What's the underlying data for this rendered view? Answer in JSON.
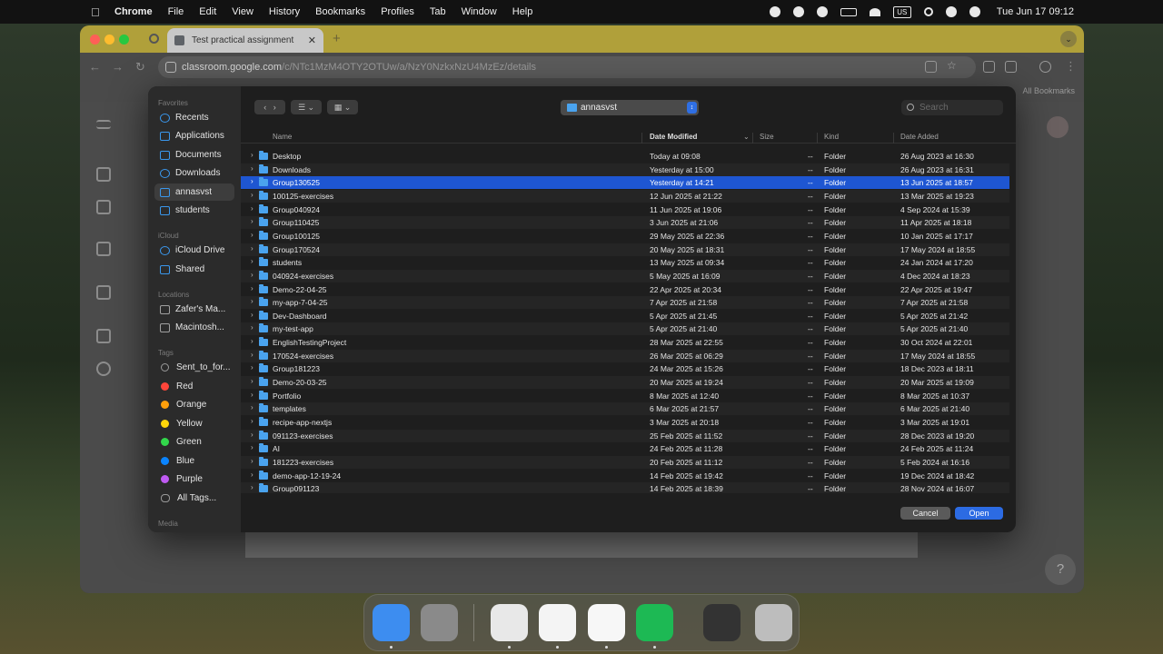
{
  "menubar": {
    "app": "Chrome",
    "items": [
      "File",
      "Edit",
      "View",
      "History",
      "Bookmarks",
      "Profiles",
      "Tab",
      "Window",
      "Help"
    ],
    "input_source": "US",
    "clock": "Tue Jun 17  09:12"
  },
  "browser": {
    "tab_title": "Test practical assignment",
    "url_host": "classroom.google.com",
    "url_path": "/c/NTc1MzM4OTY2OTUw/a/NzY0NzkxNzU4MzEz/details",
    "bookmarks_all": "All Bookmarks"
  },
  "dialog": {
    "sidebar": {
      "favorites_label": "Favorites",
      "favorites": [
        {
          "label": "Recents",
          "icon": "clock-icon"
        },
        {
          "label": "Applications",
          "icon": "applications-icon"
        },
        {
          "label": "Documents",
          "icon": "document-icon"
        },
        {
          "label": "Downloads",
          "icon": "download-icon"
        },
        {
          "label": "annasvst",
          "icon": "home-icon"
        },
        {
          "label": "students",
          "icon": "folder-icon"
        }
      ],
      "icloud_label": "iCloud",
      "icloud": [
        {
          "label": "iCloud Drive",
          "icon": "cloud-icon"
        },
        {
          "label": "Shared",
          "icon": "shared-folder-icon"
        }
      ],
      "locations_label": "Locations",
      "locations": [
        {
          "label": "Zafer's Ma...",
          "icon": "laptop-icon"
        },
        {
          "label": "Macintosh...",
          "icon": "disk-icon"
        }
      ],
      "tags_label": "Tags",
      "tags": [
        {
          "label": "Sent_to_for...",
          "color": "#9a9a9a"
        },
        {
          "label": "Red",
          "color": "#ff453a"
        },
        {
          "label": "Orange",
          "color": "#ff9f0a"
        },
        {
          "label": "Yellow",
          "color": "#ffd60a"
        },
        {
          "label": "Green",
          "color": "#32d74b"
        },
        {
          "label": "Blue",
          "color": "#0a84ff"
        },
        {
          "label": "Purple",
          "color": "#bf5af2"
        },
        {
          "label": "All Tags...",
          "color": "#9a9a9a"
        }
      ],
      "media_label": "Media"
    },
    "current_folder": "annasvst",
    "search_placeholder": "Search",
    "columns": {
      "name": "Name",
      "modified": "Date Modified",
      "size": "Size",
      "kind": "Kind",
      "added": "Date Added"
    },
    "rows": [
      {
        "name": "Desktop",
        "modified": "Today at 09:08",
        "size": "--",
        "kind": "Folder",
        "added": "26 Aug 2023 at 16:30"
      },
      {
        "name": "Downloads",
        "modified": "Yesterday at 15:00",
        "size": "--",
        "kind": "Folder",
        "added": "26 Aug 2023 at 16:31"
      },
      {
        "name": "Group130525",
        "modified": "Yesterday at 14:21",
        "size": "--",
        "kind": "Folder",
        "added": "13 Jun 2025 at 18:57"
      },
      {
        "name": "100125-exercises",
        "modified": "12 Jun 2025 at 21:22",
        "size": "--",
        "kind": "Folder",
        "added": "13 Mar 2025 at 19:23"
      },
      {
        "name": "Group040924",
        "modified": "11 Jun 2025 at 19:06",
        "size": "--",
        "kind": "Folder",
        "added": "4 Sep 2024 at 15:39"
      },
      {
        "name": "Group110425",
        "modified": "3 Jun 2025 at 21:06",
        "size": "--",
        "kind": "Folder",
        "added": "11 Apr 2025 at 18:18"
      },
      {
        "name": "Group100125",
        "modified": "29 May 2025 at 22:36",
        "size": "--",
        "kind": "Folder",
        "added": "10 Jan 2025 at 17:17"
      },
      {
        "name": "Group170524",
        "modified": "20 May 2025 at 18:31",
        "size": "--",
        "kind": "Folder",
        "added": "17 May 2024 at 18:55"
      },
      {
        "name": "students",
        "modified": "13 May 2025 at 09:34",
        "size": "--",
        "kind": "Folder",
        "added": "24 Jan 2024 at 17:20"
      },
      {
        "name": "040924-exercises",
        "modified": "5 May 2025 at 16:09",
        "size": "--",
        "kind": "Folder",
        "added": "4 Dec 2024 at 18:23"
      },
      {
        "name": "Demo-22-04-25",
        "modified": "22 Apr 2025 at 20:34",
        "size": "--",
        "kind": "Folder",
        "added": "22 Apr 2025 at 19:47"
      },
      {
        "name": "my-app-7-04-25",
        "modified": "7 Apr 2025 at 21:58",
        "size": "--",
        "kind": "Folder",
        "added": "7 Apr 2025 at 21:58"
      },
      {
        "name": "Dev-Dashboard",
        "modified": "5 Apr 2025 at 21:45",
        "size": "--",
        "kind": "Folder",
        "added": "5 Apr 2025 at 21:42"
      },
      {
        "name": "my-test-app",
        "modified": "5 Apr 2025 at 21:40",
        "size": "--",
        "kind": "Folder",
        "added": "5 Apr 2025 at 21:40"
      },
      {
        "name": "EnglishTestingProject",
        "modified": "28 Mar 2025 at 22:55",
        "size": "--",
        "kind": "Folder",
        "added": "30 Oct 2024 at 22:01"
      },
      {
        "name": "170524-exercises",
        "modified": "26 Mar 2025 at 06:29",
        "size": "--",
        "kind": "Folder",
        "added": "17 May 2024 at 18:55"
      },
      {
        "name": "Group181223",
        "modified": "24 Mar 2025 at 15:26",
        "size": "--",
        "kind": "Folder",
        "added": "18 Dec 2023 at 18:11"
      },
      {
        "name": "Demo-20-03-25",
        "modified": "20 Mar 2025 at 19:24",
        "size": "--",
        "kind": "Folder",
        "added": "20 Mar 2025 at 19:09"
      },
      {
        "name": "Portfolio",
        "modified": "8 Mar 2025 at 12:40",
        "size": "--",
        "kind": "Folder",
        "added": "8 Mar 2025 at 10:37"
      },
      {
        "name": "templates",
        "modified": "6 Mar 2025 at 21:57",
        "size": "--",
        "kind": "Folder",
        "added": "6 Mar 2025 at 21:40"
      },
      {
        "name": "recipe-app-nextjs",
        "modified": "3 Mar 2025 at 20:18",
        "size": "--",
        "kind": "Folder",
        "added": "3 Mar 2025 at 19:01"
      },
      {
        "name": "091123-exercises",
        "modified": "25 Feb 2025 at 11:52",
        "size": "--",
        "kind": "Folder",
        "added": "28 Dec 2023 at 19:20"
      },
      {
        "name": "AI",
        "modified": "24 Feb 2025 at 11:28",
        "size": "--",
        "kind": "Folder",
        "added": "24 Feb 2025 at 11:24"
      },
      {
        "name": "181223-exercises",
        "modified": "20 Feb 2025 at 11:12",
        "size": "--",
        "kind": "Folder",
        "added": "5 Feb 2024 at 16:16"
      },
      {
        "name": "demo-app-12-19-24",
        "modified": "14 Feb 2025 at 19:42",
        "size": "--",
        "kind": "Folder",
        "added": "19 Dec 2024 at 18:42"
      },
      {
        "name": "Group091123",
        "modified": "14 Feb 2025 at 18:39",
        "size": "--",
        "kind": "Folder",
        "added": "28 Nov 2024 at 16:07"
      }
    ],
    "selected_row": "Group130525",
    "cancel_label": "Cancel",
    "open_label": "Open"
  },
  "dock": {
    "apps": [
      {
        "name": "finder",
        "color": "#3d8df0"
      },
      {
        "name": "launchpad",
        "color": "#8a8a8a"
      },
      {
        "name": "chrome",
        "color": "#e8e8e8"
      },
      {
        "name": "vscode",
        "color": "#f4f4f4"
      },
      {
        "name": "slack",
        "color": "#f7f7f7"
      },
      {
        "name": "spotify",
        "color": "#1db954"
      },
      {
        "name": "screenshot-preview",
        "color": "#333333"
      },
      {
        "name": "trash",
        "color": "#bdbdbd"
      }
    ]
  }
}
